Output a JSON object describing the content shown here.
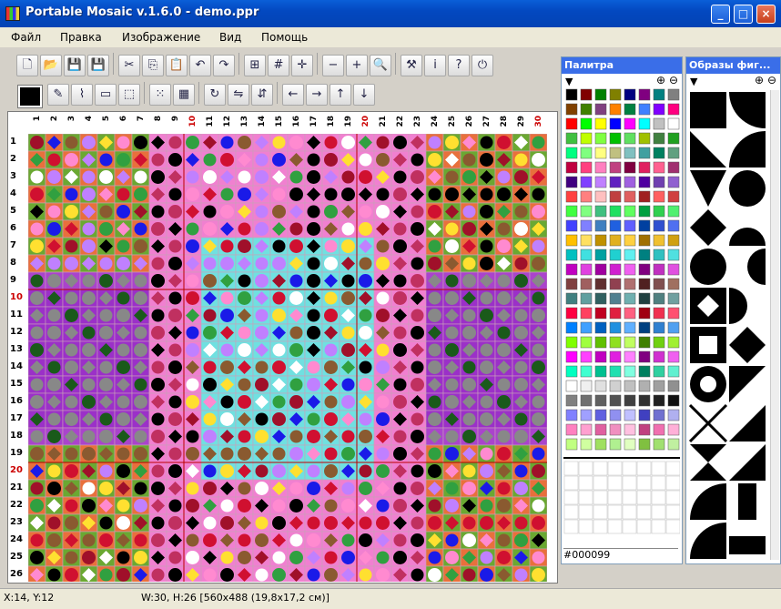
{
  "window": {
    "title": "Portable Mosaic v.1.6.0 - demo.ppr",
    "minimize": "_",
    "maximize": "□",
    "close": "×"
  },
  "menu": [
    {
      "label": "Файл"
    },
    {
      "label": "Правка"
    },
    {
      "label": "Изображение"
    },
    {
      "label": "Вид"
    },
    {
      "label": "Помощь"
    }
  ],
  "toolbar1": [
    {
      "name": "new-file-icon",
      "glyph": "🗋"
    },
    {
      "name": "open-icon",
      "glyph": "📂"
    },
    {
      "name": "save-icon",
      "glyph": "💾"
    },
    {
      "name": "save-as-icon",
      "glyph": "💾"
    },
    {
      "name": "cut-icon",
      "glyph": "✂"
    },
    {
      "name": "copy-icon",
      "glyph": "⎘"
    },
    {
      "name": "paste-icon",
      "glyph": "📋"
    },
    {
      "name": "undo-icon",
      "glyph": "↶"
    },
    {
      "name": "redo-icon",
      "glyph": "↷"
    },
    {
      "name": "grid-ruler-icon",
      "glyph": "⊞"
    },
    {
      "name": "grid-icon",
      "glyph": "#"
    },
    {
      "name": "center-icon",
      "glyph": "✛"
    },
    {
      "name": "zoom-out-icon",
      "glyph": "−"
    },
    {
      "name": "zoom-in-icon",
      "glyph": "+"
    },
    {
      "name": "zoom-icon",
      "glyph": "🔍"
    },
    {
      "name": "tools-icon",
      "glyph": "⚒"
    },
    {
      "name": "info-icon",
      "glyph": "i"
    },
    {
      "name": "help-icon",
      "glyph": "?"
    },
    {
      "name": "exit-icon",
      "glyph": "⏻"
    }
  ],
  "toolbar2": [
    {
      "name": "pencil-icon",
      "glyph": "✎"
    },
    {
      "name": "eyedropper-icon",
      "glyph": "⌇"
    },
    {
      "name": "eraser-icon",
      "glyph": "▭"
    },
    {
      "name": "select-icon",
      "glyph": "⬚"
    },
    {
      "name": "grid-dots-icon",
      "glyph": "⁙"
    },
    {
      "name": "grid-fill-icon",
      "glyph": "▦"
    },
    {
      "name": "rotate-icon",
      "glyph": "↻"
    },
    {
      "name": "flip-h-icon",
      "glyph": "⇋"
    },
    {
      "name": "flip-v-icon",
      "glyph": "⇵"
    },
    {
      "name": "arrow-left-icon",
      "glyph": "←"
    },
    {
      "name": "arrow-right-icon",
      "glyph": "→"
    },
    {
      "name": "arrow-up-icon",
      "glyph": "↑"
    },
    {
      "name": "arrow-down-icon",
      "glyph": "↓"
    }
  ],
  "current_color": "#000000",
  "columns": [
    "1",
    "2",
    "3",
    "4",
    "5",
    "6",
    "7",
    "8",
    "9",
    "10",
    "11",
    "12",
    "13",
    "14",
    "15",
    "16",
    "17",
    "18",
    "19",
    "20",
    "21",
    "22",
    "23",
    "24",
    "25",
    "26",
    "27",
    "28",
    "29",
    "30"
  ],
  "rows": [
    "1",
    "2",
    "3",
    "4",
    "5",
    "6",
    "7",
    "8",
    "9",
    "10",
    "11",
    "12",
    "13",
    "14",
    "15",
    "16",
    "17",
    "18",
    "19",
    "20",
    "21",
    "22",
    "23",
    "24",
    "25",
    "26"
  ],
  "palette_panel": {
    "title": "Палитра",
    "selected_hex": "#000099"
  },
  "shapes_panel": {
    "title": "Образы фиг..."
  },
  "status": {
    "cursor": "X:14, Y:12",
    "size": "W:30, H:26 [560x488 (19,8x17,2 см)]"
  },
  "colors": {
    "titlebar": "#0348c0",
    "menubar": "#ece9d8",
    "panel_title": "#3a6ee8"
  }
}
